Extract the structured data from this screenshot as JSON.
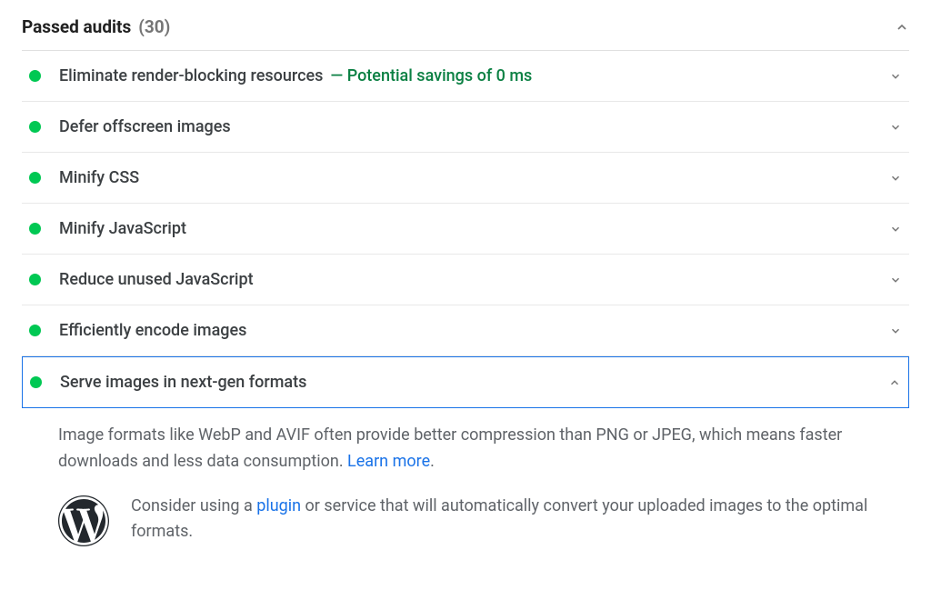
{
  "header": {
    "title": "Passed audits",
    "count": "(30)"
  },
  "audits": [
    {
      "title": "Eliminate render-blocking resources",
      "note": "— Potential savings of 0 ms"
    },
    {
      "title": "Defer offscreen images"
    },
    {
      "title": "Minify CSS"
    },
    {
      "title": "Minify JavaScript"
    },
    {
      "title": "Reduce unused JavaScript"
    },
    {
      "title": "Efficiently encode images"
    },
    {
      "title": "Serve images in next-gen formats",
      "expanded": true
    }
  ],
  "detail": {
    "desc_part1": "Image formats like WebP and AVIF often provide better compression than PNG or JPEG, which means faster downloads and less data consumption. ",
    "learn_more": "Learn more",
    "period": "."
  },
  "stack_pack": {
    "text_before": "Consider using a ",
    "link_text": "plugin",
    "text_after": " or service that will automatically convert your uploaded images to the optimal formats."
  },
  "icons": {
    "wordpress": "wordpress-icon"
  },
  "colors": {
    "pass": "#00c853",
    "savings_text": "#0b8043",
    "link": "#1a73e8",
    "selected_border": "#1a73e8"
  }
}
